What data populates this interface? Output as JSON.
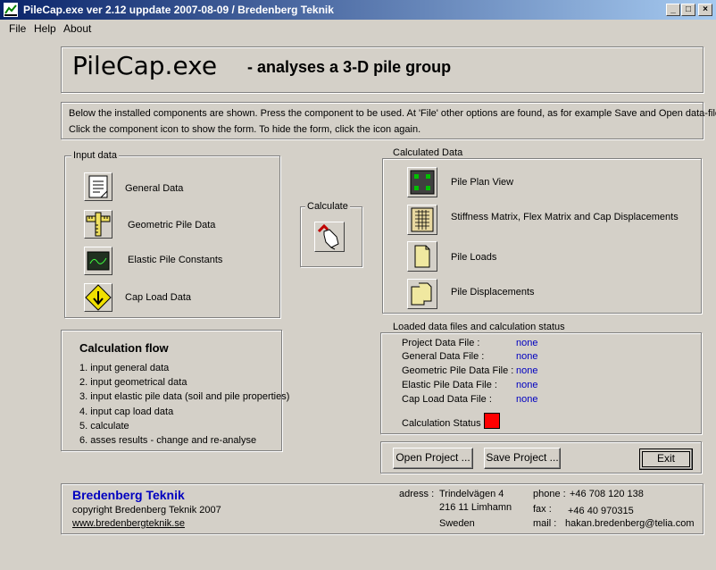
{
  "window": {
    "title": "PileCap.exe  ver 2.12   uppdate 2007-08-09 / Bredenberg Teknik",
    "minimize": "_",
    "maximize": "□",
    "close": "×"
  },
  "menu": [
    "File",
    "Help",
    "About"
  ],
  "header": {
    "title": "PileCap.exe",
    "subtitle": "- analyses a 3-D pile group"
  },
  "info": {
    "line1": "Below the installed components are shown. Press the component to be used. At 'File' other options are found, as for example Save and Open data-files.",
    "line2": "Click the component icon to show the form. To hide the form, click the icon again."
  },
  "input_data": {
    "label": "Input data",
    "items": [
      {
        "label": "General Data",
        "icon": "document-icon"
      },
      {
        "label": "Geometric Pile Data",
        "icon": "ruler-icon"
      },
      {
        "label": "Elastic Pile Constants",
        "icon": "graph-icon"
      },
      {
        "label": "Cap Load Data",
        "icon": "load-arrow-icon"
      }
    ]
  },
  "calculate": {
    "label": "Calculate",
    "icon": "hand-pointer-icon"
  },
  "calculated_data": {
    "label": "Calculated Data",
    "items": [
      {
        "label": "Pile Plan View",
        "icon": "plan-view-icon"
      },
      {
        "label": "Stiffness Matrix, Flex Matrix and Cap Displacements",
        "icon": "matrix-icon"
      },
      {
        "label": "Pile Loads",
        "icon": "folder-icon"
      },
      {
        "label": "Pile Displacements",
        "icon": "folders-icon"
      }
    ]
  },
  "flow": {
    "title": "Calculation flow",
    "steps": [
      "1. input general data",
      "2. input geometrical data",
      "3. input elastic pile data (soil and pile properties)",
      "4. input cap load data",
      "5. calculate",
      "6. asses results - change and re-analyse"
    ]
  },
  "files": {
    "label": "Loaded data files and calculation status",
    "rows": [
      {
        "label": "Project Data File :",
        "value": "none"
      },
      {
        "label": "General Data File :",
        "value": "none"
      },
      {
        "label": "Geometric Pile Data File :",
        "value": "none"
      },
      {
        "label": "Elastic Pile Data File :",
        "value": "none"
      },
      {
        "label": "Cap Load Data File :",
        "value": "none"
      }
    ],
    "status_label": "Calculation Status",
    "status_color": "#ff0000"
  },
  "buttons": {
    "open": "Open Project ...",
    "save": "Save Project ...",
    "exit": "Exit"
  },
  "footer": {
    "company": "Bredenberg Teknik",
    "copyright": "copyright Bredenberg Teknik  2007",
    "website": "www.bredenbergteknik.se",
    "adress_label": "adress :",
    "adress1": "Trindelvägen 4",
    "adress2": "216 11 Limhamn",
    "adress3": "Sweden",
    "phone_label": "phone :",
    "phone": "+46 708 120 138",
    "fax_label": "fax :",
    "fax": "+46 40 970315",
    "mail_label": "mail :",
    "mail": "hakan.bredenberg@telia.com"
  }
}
